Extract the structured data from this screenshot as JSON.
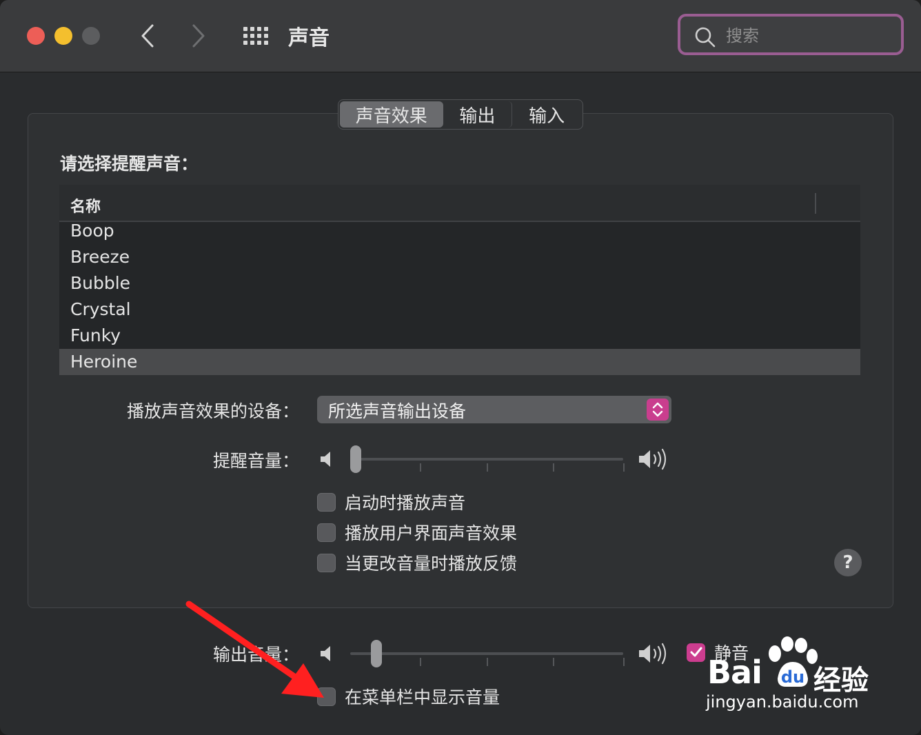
{
  "window": {
    "title": "声音",
    "search_placeholder": "搜索"
  },
  "tabs": [
    {
      "label": "声音效果",
      "active": true
    },
    {
      "label": "输出",
      "active": false
    },
    {
      "label": "输入",
      "active": false
    }
  ],
  "sound_effects": {
    "section_label": "请选择提醒声音：",
    "list_header": "名称",
    "sounds": [
      "Boop",
      "Breeze",
      "Bubble",
      "Crystal",
      "Funky",
      "Heroine"
    ],
    "selected_sound": "Heroine",
    "device_label": "播放声音效果的设备：",
    "device_value": "所选声音输出设备",
    "alert_volume_label": "提醒音量：",
    "alert_volume_level": 0.0,
    "checkboxes": [
      {
        "label": "启动时播放声音",
        "checked": false
      },
      {
        "label": "播放用户界面声音效果",
        "checked": false
      },
      {
        "label": "当更改音量时播放反馈",
        "checked": false
      }
    ],
    "help_label": "?"
  },
  "output": {
    "output_volume_label": "输出音量：",
    "output_volume_level": 0.08,
    "mute_label": "静音",
    "mute_checked": true,
    "show_in_menubar_label": "在菜单栏中显示音量",
    "show_in_menubar_checked": false
  },
  "watermark": {
    "brand_left": "Bai",
    "brand_right": "经验",
    "url": "jingyan.baidu.com"
  },
  "colors": {
    "accent": "#cc3d8f",
    "search_focus_ring": "#9a5d92",
    "close": "#ed5e57",
    "minimize": "#f4bf2e",
    "arrow": "#ff2020"
  },
  "icons": {
    "search": "magnifier-icon",
    "back": "chevron-left-icon",
    "forward": "chevron-right-icon",
    "all_prefs": "grid-icon",
    "vol_low": "speaker-low-icon",
    "vol_high": "speaker-high-icon",
    "stepper": "up-down-chevron-icon",
    "checkmark": "checkmark-icon"
  }
}
